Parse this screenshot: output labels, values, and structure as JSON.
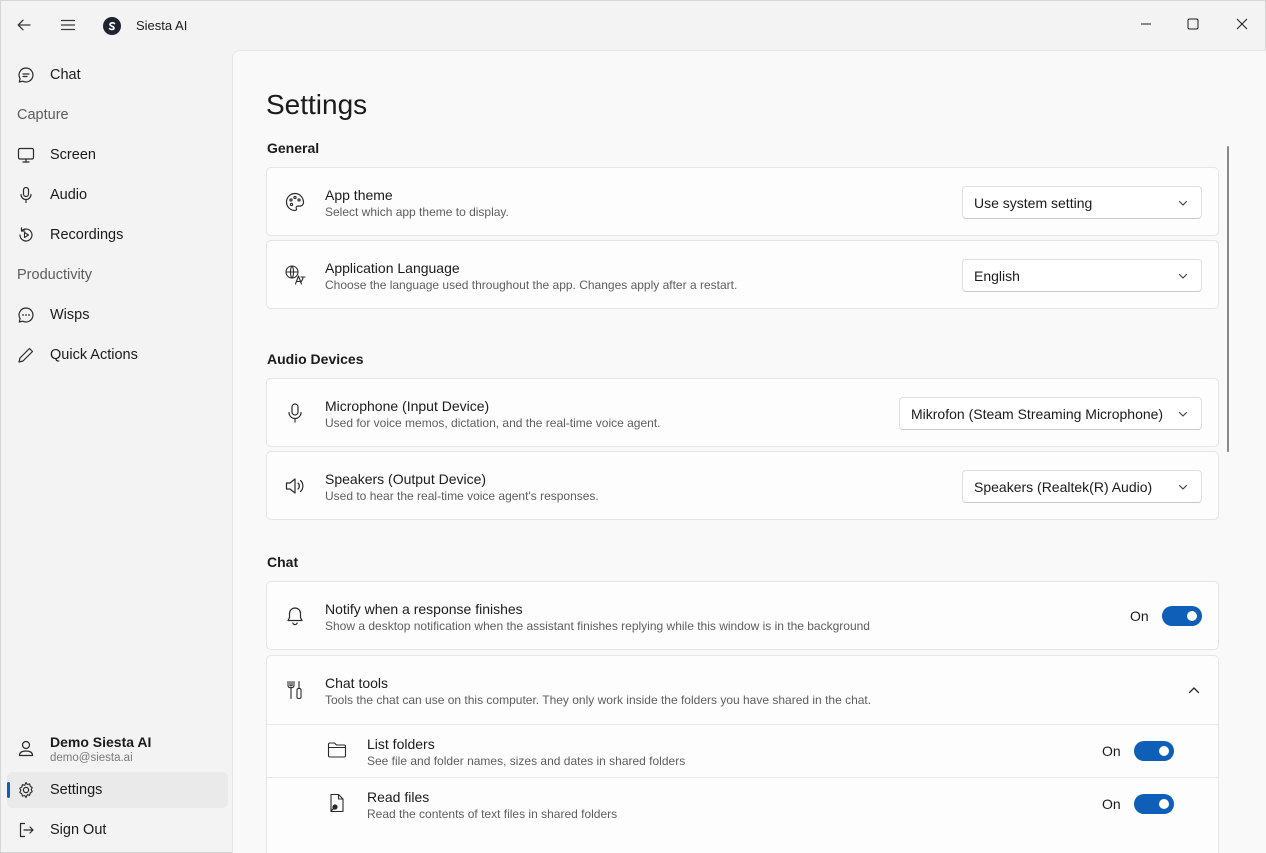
{
  "app": {
    "title": "Siesta AI"
  },
  "sidebar": {
    "items": [
      {
        "label": "Chat",
        "icon": "chat-bubble-icon"
      },
      {
        "group": "Capture"
      },
      {
        "label": "Screen",
        "icon": "monitor-icon"
      },
      {
        "label": "Audio",
        "icon": "microphone-icon"
      },
      {
        "label": "Recordings",
        "icon": "history-icon"
      },
      {
        "group": "Productivity"
      },
      {
        "label": "Wisps",
        "icon": "chat-dots-icon"
      },
      {
        "label": "Quick Actions",
        "icon": "pencil-icon"
      }
    ],
    "profile": {
      "name": "Demo Siesta AI",
      "email": "demo@siesta.ai"
    },
    "settings_label": "Settings",
    "signout_label": "Sign Out"
  },
  "page": {
    "title": "Settings"
  },
  "sections": {
    "general": {
      "title": "General",
      "app_theme": {
        "title": "App theme",
        "desc": "Select which app theme to display.",
        "value": "Use system setting"
      },
      "language": {
        "title": "Application Language",
        "desc": "Choose the language used throughout the app. Changes apply after a restart.",
        "value": "English"
      }
    },
    "audio": {
      "title": "Audio Devices",
      "microphone": {
        "title": "Microphone (Input Device)",
        "desc": "Used for voice memos, dictation, and the real-time voice agent.",
        "value": "Mikrofon (Steam Streaming Microphone)"
      },
      "speakers": {
        "title": "Speakers (Output Device)",
        "desc": "Used to hear the real-time voice agent's responses.",
        "value": "Speakers (Realtek(R) Audio)"
      }
    },
    "chat": {
      "title": "Chat",
      "notify": {
        "title": "Notify when a response finishes",
        "desc": "Show a desktop notification when the assistant finishes replying while this window is in the background",
        "state": "On"
      },
      "tools": {
        "title": "Chat tools",
        "desc": "Tools the chat can use on this computer. They only work inside the folders you have shared in the chat.",
        "list_folders": {
          "title": "List folders",
          "desc": "See file and folder names, sizes and dates in shared folders",
          "state": "On"
        },
        "read_files": {
          "title": "Read files",
          "desc": "Read the contents of text files in shared folders",
          "state": "On"
        }
      }
    }
  },
  "colors": {
    "accent": "#0f5fb8",
    "background": "#f3f3f3",
    "card": "#fdfdfd"
  }
}
